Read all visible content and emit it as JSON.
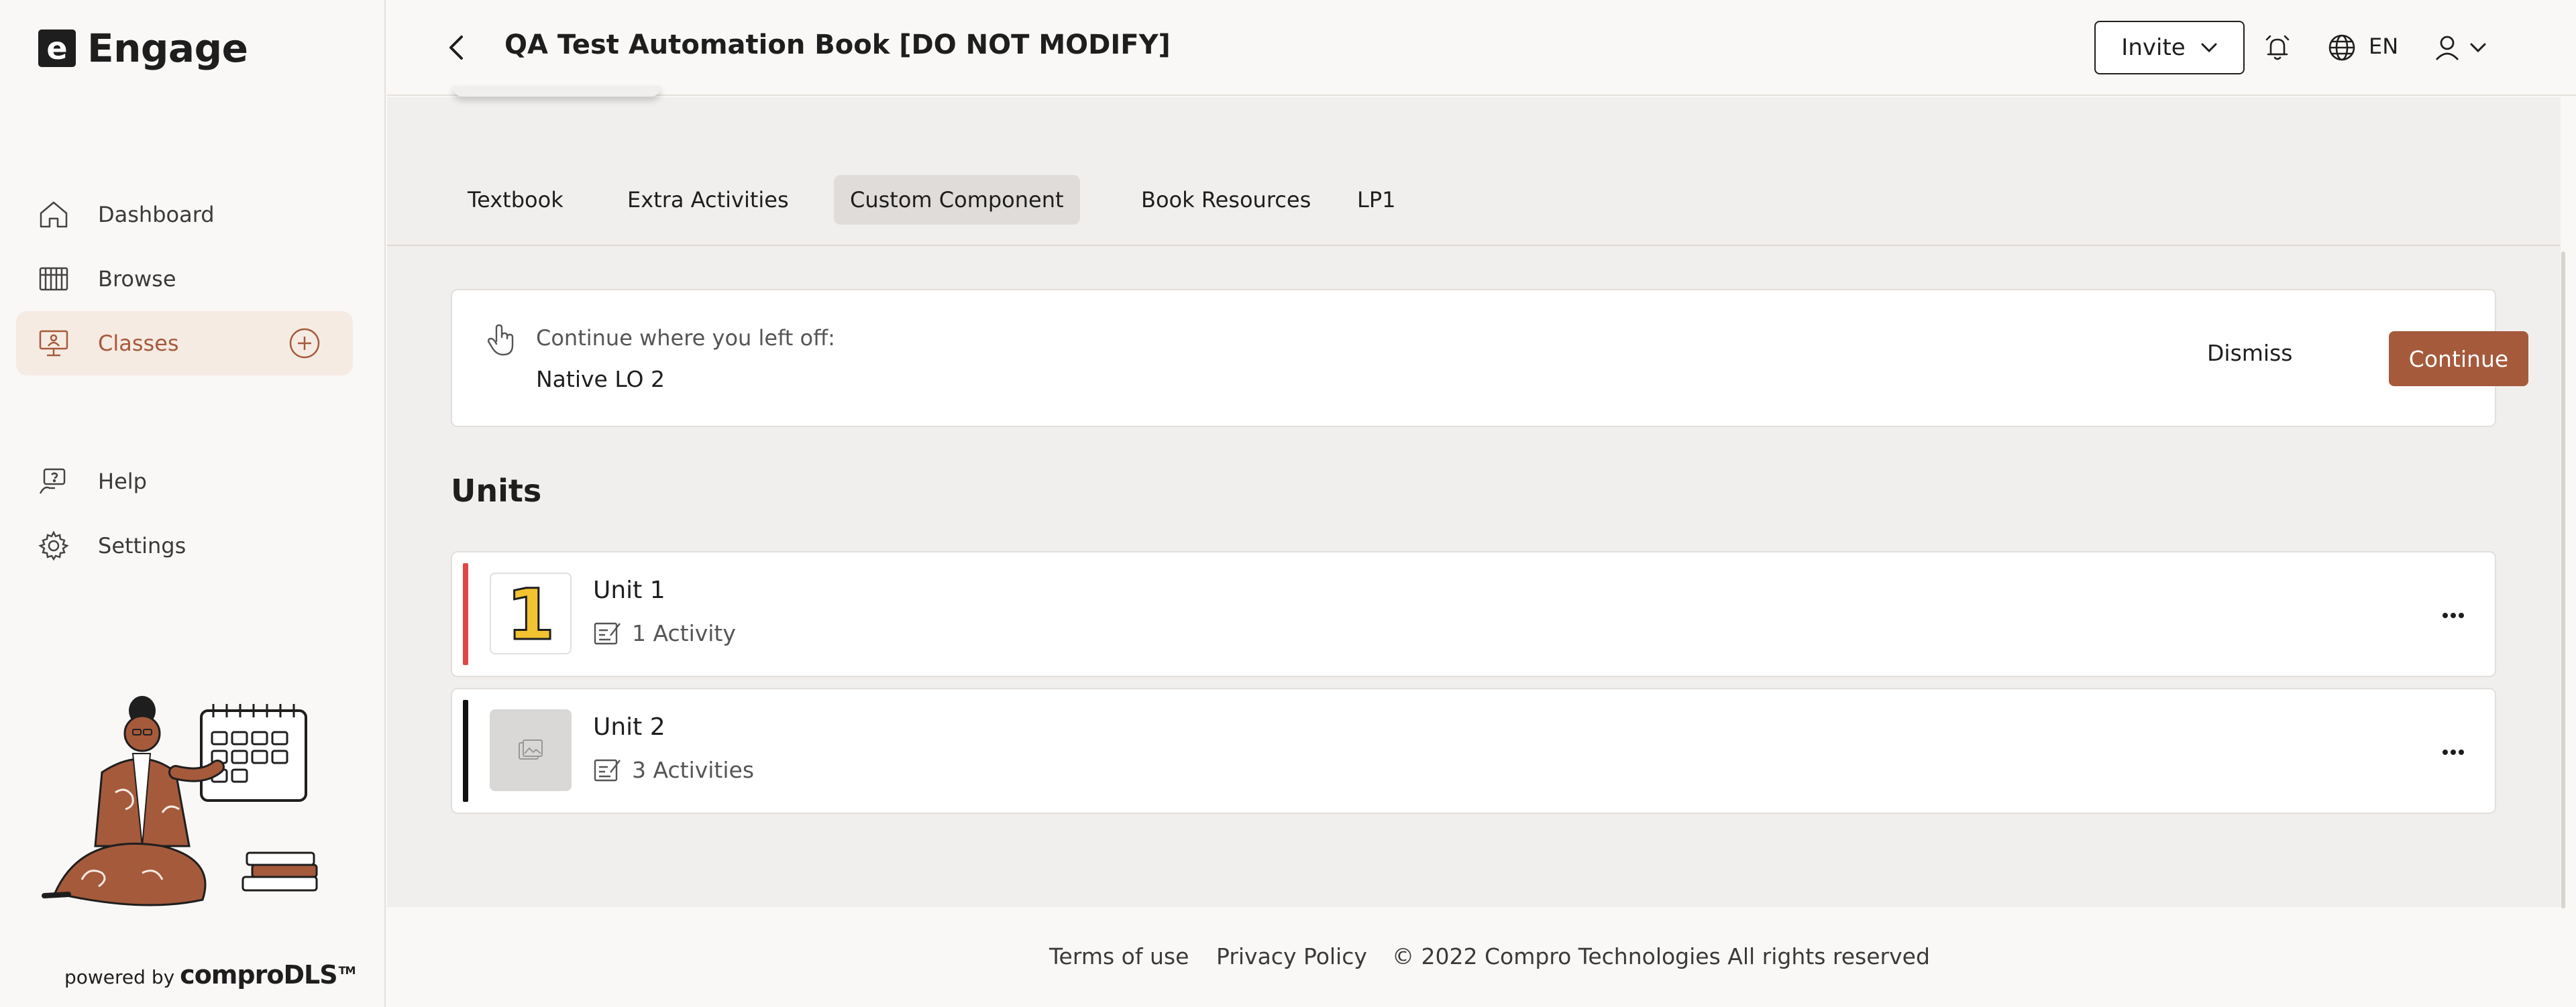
{
  "app": {
    "logo_letter": "e",
    "name": "Engage"
  },
  "sidebar": {
    "items": [
      {
        "label": "Dashboard",
        "icon": "home-icon"
      },
      {
        "label": "Browse",
        "icon": "library-icon"
      },
      {
        "label": "Classes",
        "icon": "classroom-icon",
        "active": true
      },
      {
        "label": "Help",
        "icon": "help-icon"
      },
      {
        "label": "Settings",
        "icon": "gear-icon"
      }
    ],
    "powered_by": "powered by",
    "powered_brand": "comproDLS",
    "powered_tm": "TM"
  },
  "header": {
    "title": "QA Test Automation Book [DO NOT MODIFY]",
    "invite_label": "Invite",
    "language": "EN"
  },
  "tabs": [
    {
      "label": "Textbook"
    },
    {
      "label": "Extra Activities"
    },
    {
      "label": "Custom Component",
      "active": true
    },
    {
      "label": "Book Resources"
    },
    {
      "label": "LP1"
    }
  ],
  "continue_card": {
    "label": "Continue where you left off:",
    "item": "Native LO 2",
    "dismiss_label": "Dismiss",
    "continue_label": "Continue"
  },
  "units": {
    "heading": "Units",
    "items": [
      {
        "name": "Unit 1",
        "activities": "1 Activity",
        "thumb_text": "1",
        "accent": "#e04848"
      },
      {
        "name": "Unit 2",
        "activities": "3 Activities",
        "thumb_text": "",
        "accent": "#111111"
      }
    ]
  },
  "footer": {
    "terms": "Terms of use",
    "privacy": "Privacy Policy",
    "copyright": "© 2022 Compro Technologies All rights reserved"
  },
  "colors": {
    "accent": "#a55a3c",
    "active_bg": "#f6ebe3",
    "unit1_accent": "#e04848",
    "unit2_accent": "#111111"
  }
}
